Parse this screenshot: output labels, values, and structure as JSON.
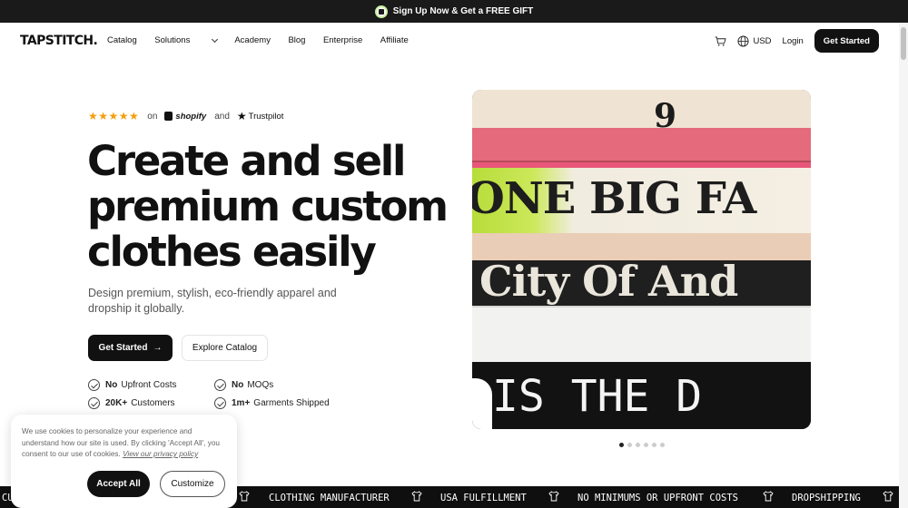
{
  "announcement": {
    "text": "Sign Up Now & Get a FREE GIFT"
  },
  "header": {
    "logo": "TAPSTITCH.",
    "nav": [
      "Catalog",
      "Solutions",
      "Academy",
      "Blog",
      "Enterprise",
      "Affiliate"
    ],
    "currency": "USD",
    "login": "Login",
    "cta": "Get Started"
  },
  "hero": {
    "stars_glyph": "★★★★★",
    "rating_on": "on",
    "shopify": "shopify",
    "rating_and": "and",
    "trustpilot": "Trustpilot",
    "title_lines": [
      "Create and sell",
      "premium custom",
      "clothes easily"
    ],
    "subtitle": "Design premium, stylish, eco-friendly apparel and dropship it globally.",
    "primary_cta": "Get Started",
    "secondary_cta": "Explore Catalog",
    "features": [
      {
        "bold": "No",
        "text": "Upfront Costs"
      },
      {
        "bold": "No",
        "text": "MOQs"
      },
      {
        "bold": "20K+",
        "text": "Customers"
      },
      {
        "bold": "1m+",
        "text": "Garments Shipped"
      }
    ],
    "image_shirt_texts": [
      "9",
      "ONE BIG FA",
      "City Of And",
      "IS THE D"
    ],
    "carousel": {
      "count": 6,
      "active": 0
    }
  },
  "marquee": {
    "items": [
      "CU",
      "CLOTHING MANUFACTURER",
      "USA FULFILLMENT",
      "NO MINIMUMS OR UPFRONT COSTS",
      "DROPSHIPPING"
    ]
  },
  "cookie": {
    "text": "We use cookies to personalize your experience and understand how our site is used. By clicking 'Accept All', you consent to our use of cookies.",
    "link": "View our privacy policy",
    "accept": "Accept All",
    "customize": "Customize"
  },
  "colors": {
    "dark": "#111111",
    "star": "#f59e0b",
    "marquee_bg": "#0f0f0f"
  }
}
